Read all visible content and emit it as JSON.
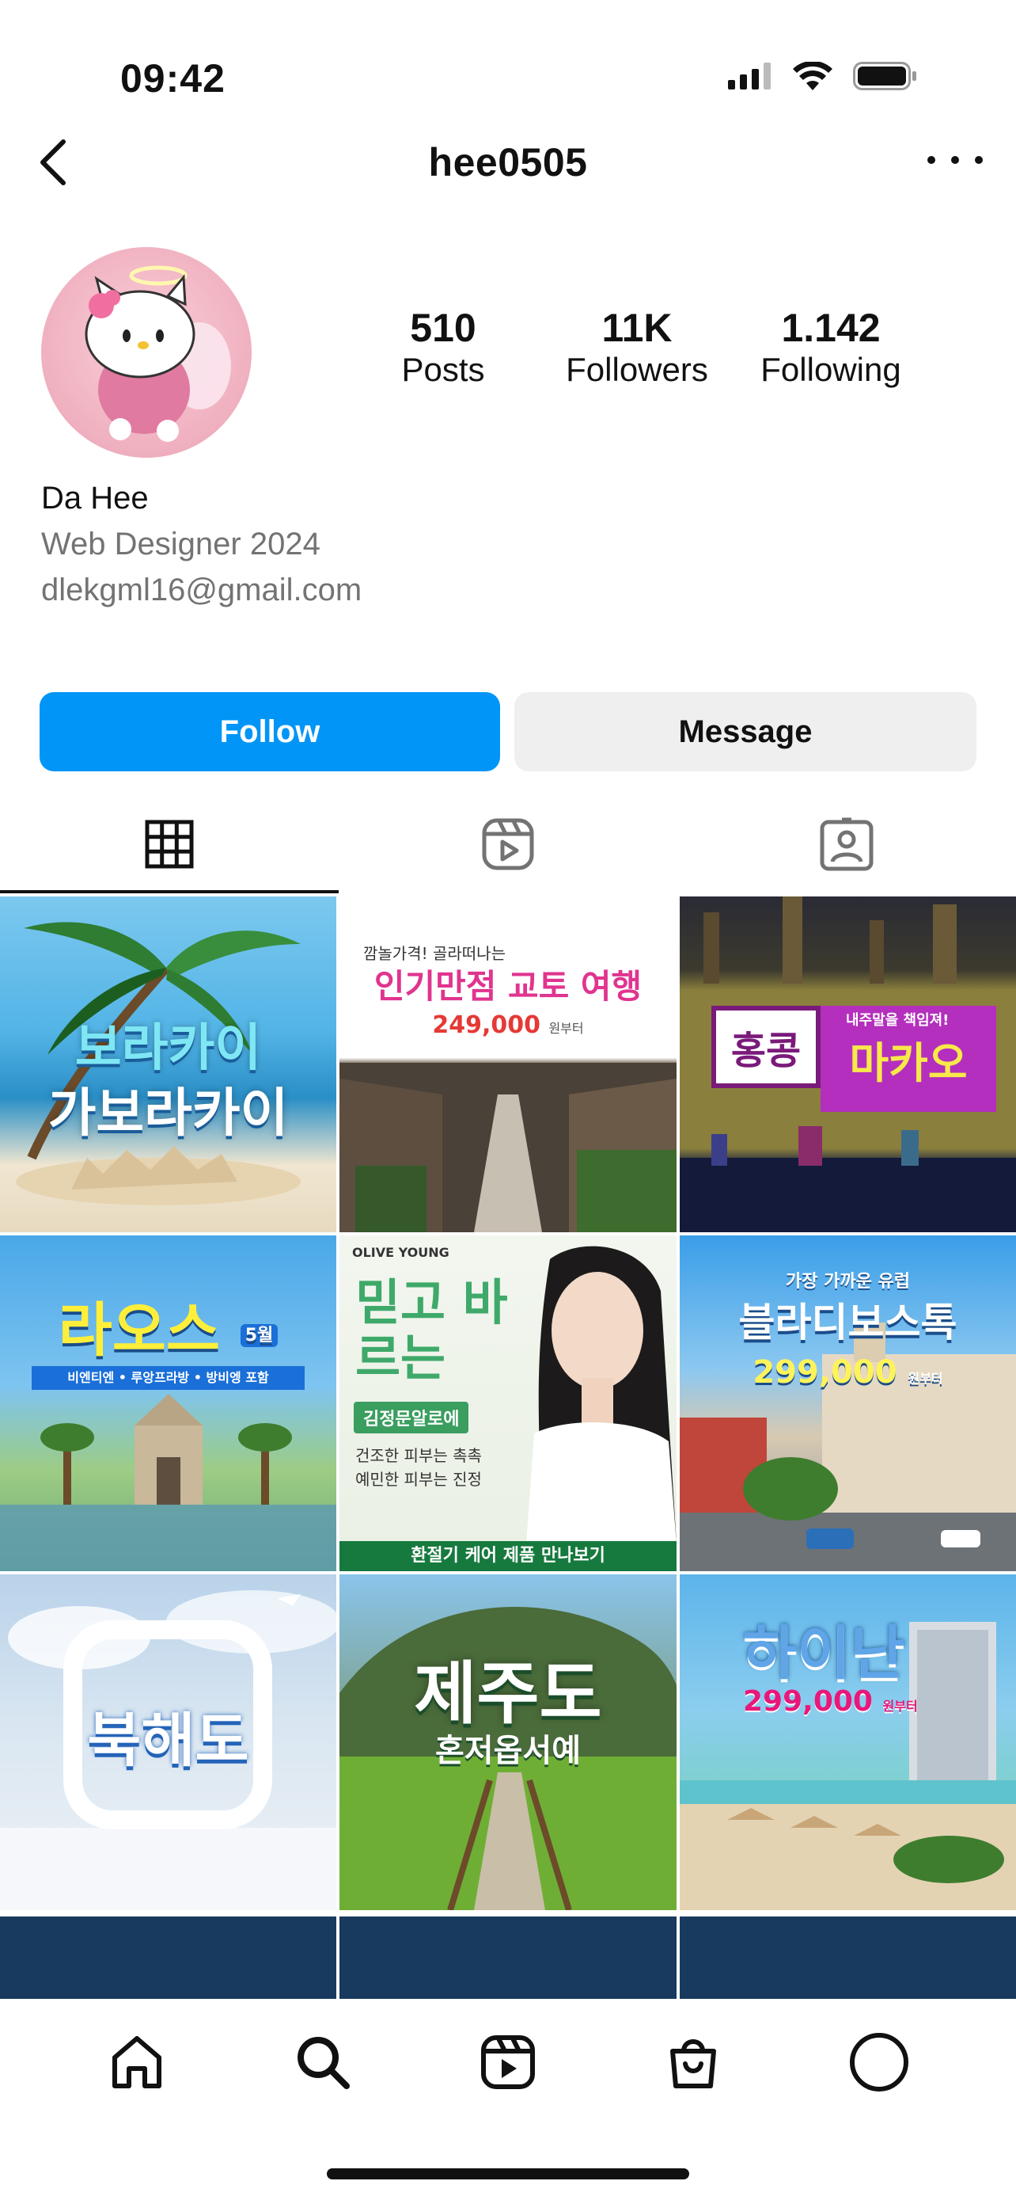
{
  "status_bar": {
    "time": "09:42"
  },
  "header": {
    "username": "hee0505"
  },
  "profile": {
    "stats": [
      {
        "value": "510",
        "label": "Posts"
      },
      {
        "value": "11K",
        "label": "Followers"
      },
      {
        "value": "1.142",
        "label": "Following"
      }
    ],
    "name": "Da Hee",
    "bio_lines": [
      "Web Designer 2024",
      "dlekgml16@gmail.com"
    ]
  },
  "actions": {
    "follow_label": "Follow",
    "message_label": "Message"
  },
  "tabs": [
    "posts-grid",
    "reels",
    "tagged"
  ],
  "colors": {
    "accent": "#0095f6",
    "button_secondary": "#efefef",
    "muted_text": "#737373"
  },
  "posts": [
    {
      "title": "보라카이",
      "subtitle": "가보라카이"
    },
    {
      "title": "인기만점 교토 여행",
      "tagline": "깜놀가격! 골라떠나는",
      "price": "249,000",
      "price_suffix": "원부터"
    },
    {
      "title": "홍콩",
      "subtitle": "마카오",
      "tag": "내주말을 책임져!"
    },
    {
      "title": "라오스",
      "month": "5월",
      "tagline": "비엔티엔 • 루앙프라방 • 방비엥 포함"
    },
    {
      "brand": "OLIVE YOUNG",
      "title": "믿고 바르는",
      "product": "김정문알로에",
      "line1": "건조한 피부는 촉촉",
      "line2": "예민한 피부는 진정",
      "cta": "환절기 케어 제품 만나보기"
    },
    {
      "tag": "가장 가까운 유럽",
      "title": "블라디보스톡",
      "price": "299,000",
      "price_suffix": "원부터"
    },
    {
      "title": "북해도"
    },
    {
      "title": "제주도",
      "subtitle": "혼저옵서예"
    },
    {
      "title": "하이난",
      "price": "299,000",
      "price_suffix": "원부터"
    }
  ],
  "bottom_nav": [
    "home-icon",
    "search-icon",
    "reels-icon",
    "shop-icon",
    "profile-icon"
  ]
}
